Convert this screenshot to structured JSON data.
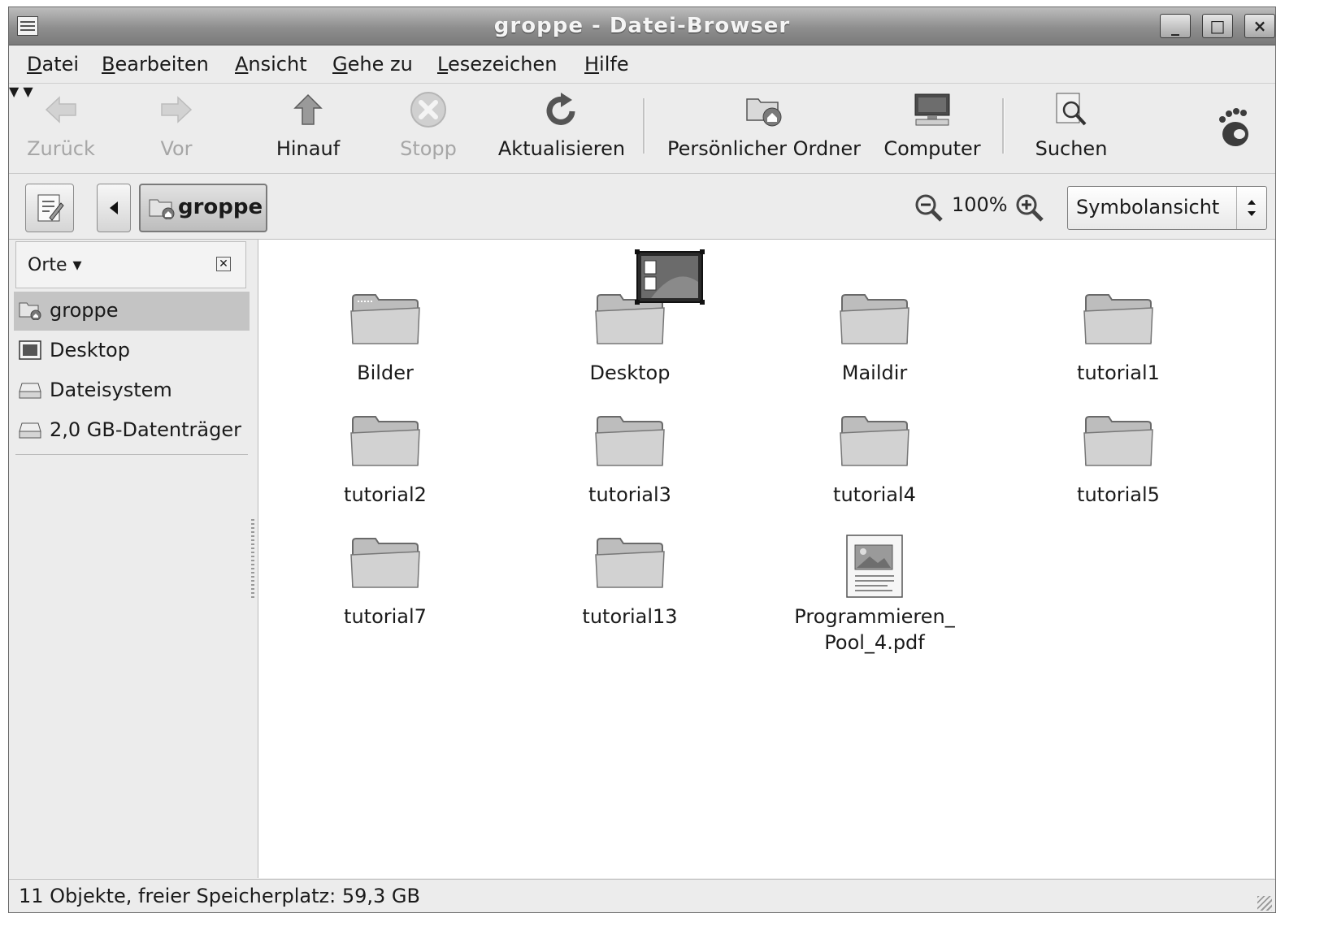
{
  "window": {
    "title": "groppe - Datei-Browser",
    "controls": {
      "minimize": "_",
      "maximize": "□",
      "close": "×"
    }
  },
  "menubar": {
    "items": [
      {
        "key": "D",
        "rest": "atei"
      },
      {
        "key": "B",
        "rest": "earbeiten"
      },
      {
        "key": "A",
        "rest": "nsicht"
      },
      {
        "key": "G",
        "rest": "ehe zu"
      },
      {
        "key": "L",
        "rest": "esezeichen"
      },
      {
        "key": "H",
        "rest": "ilfe"
      }
    ]
  },
  "toolbar": {
    "back": "Zurück",
    "forward": "Vor",
    "up": "Hinauf",
    "stop": "Stopp",
    "reload": "Aktualisieren",
    "home": "Persönlicher Ordner",
    "computer": "Computer",
    "search": "Suchen"
  },
  "location": {
    "current_folder": "groppe",
    "zoom_level": "100%",
    "view_mode": "Symbolansicht"
  },
  "sidebar": {
    "header": "Orte",
    "places": [
      {
        "label": "groppe",
        "icon": "home-folder-icon",
        "selected": true
      },
      {
        "label": "Desktop",
        "icon": "desktop-icon",
        "selected": false
      },
      {
        "label": "Dateisystem",
        "icon": "drive-icon",
        "selected": false
      },
      {
        "label": "2,0 GB-Datenträger",
        "icon": "drive-icon",
        "selected": false
      }
    ]
  },
  "files": [
    {
      "name": "Bilder",
      "type": "folder"
    },
    {
      "name": "Desktop",
      "type": "folder"
    },
    {
      "name": "Maildir",
      "type": "folder"
    },
    {
      "name": "tutorial1",
      "type": "folder"
    },
    {
      "name": "tutorial2",
      "type": "folder"
    },
    {
      "name": "tutorial3",
      "type": "folder"
    },
    {
      "name": "tutorial4",
      "type": "folder"
    },
    {
      "name": "tutorial5",
      "type": "folder"
    },
    {
      "name": "tutorial7",
      "type": "folder"
    },
    {
      "name": "tutorial13",
      "type": "folder"
    },
    {
      "name": "Programmieren_\nPool_4.pdf",
      "type": "pdf"
    }
  ],
  "status": {
    "text": "11 Objekte, freier Speicherplatz: 59,3 GB"
  }
}
